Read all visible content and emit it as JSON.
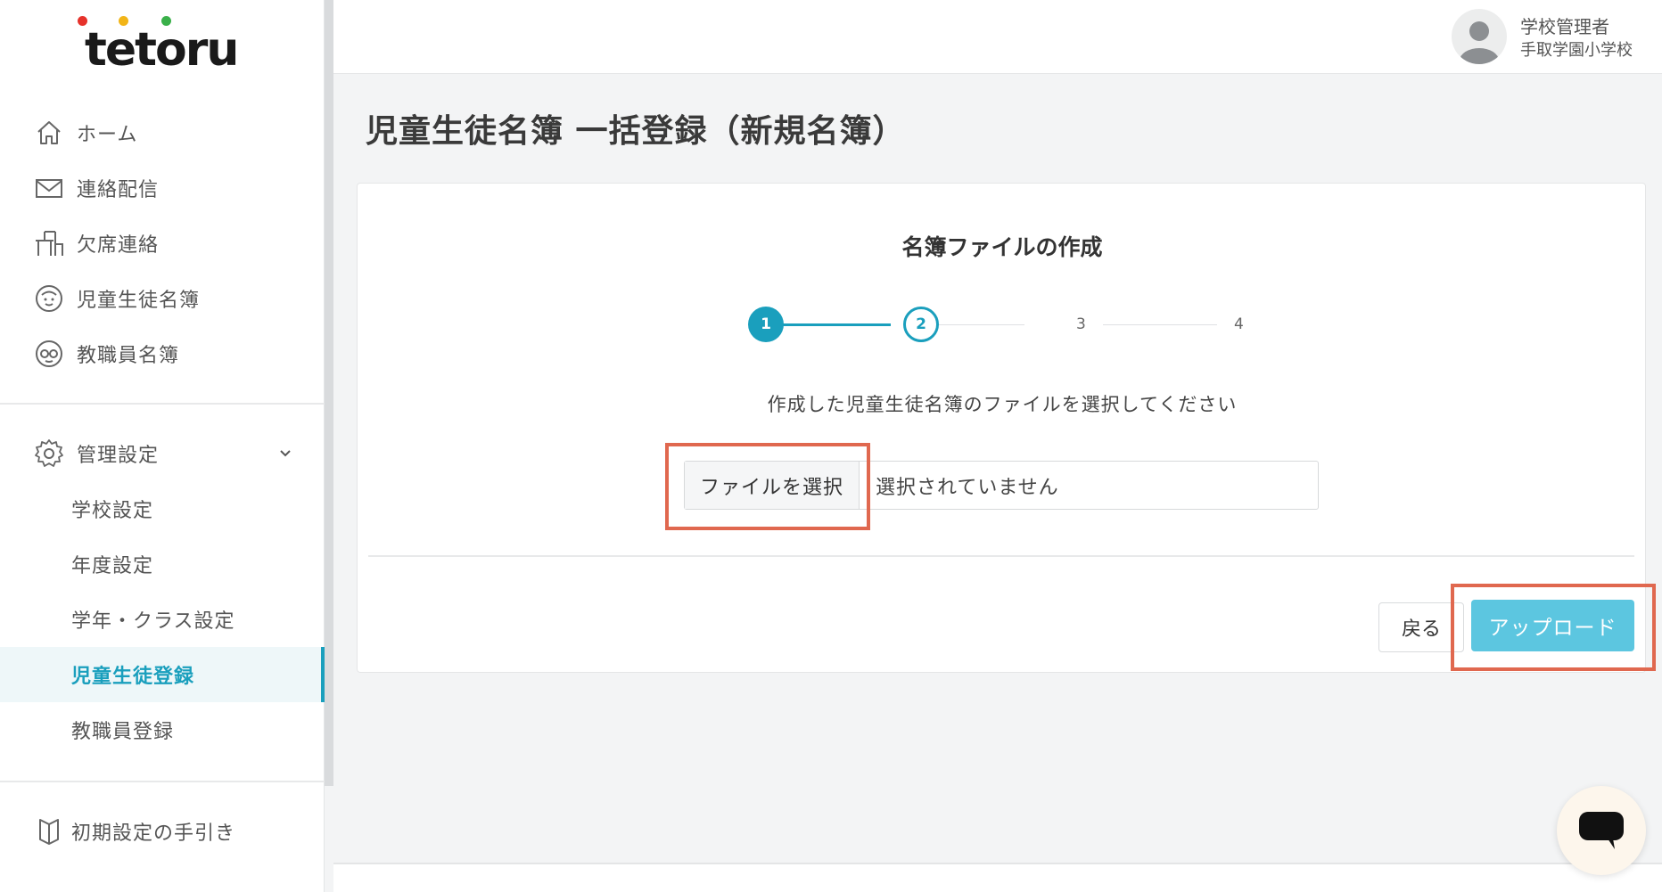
{
  "app": {
    "logo_text": "tetoru",
    "logo_colors": [
      "#e6322b",
      "#f2b518",
      "#3ab04a"
    ]
  },
  "sidebar": {
    "items": [
      {
        "label": "ホーム",
        "icon": "home-icon"
      },
      {
        "label": "連絡配信",
        "icon": "mail-icon"
      },
      {
        "label": "欠席連絡",
        "icon": "desk-chair-icon"
      },
      {
        "label": "児童生徒名簿",
        "icon": "student-face-icon"
      },
      {
        "label": "教職員名簿",
        "icon": "teacher-face-icon"
      }
    ],
    "admin": {
      "label": "管理設定",
      "icon": "gear-icon"
    },
    "sub_items": [
      {
        "label": "学校設定",
        "active": false
      },
      {
        "label": "年度設定",
        "active": false
      },
      {
        "label": "学年・クラス設定",
        "active": false
      },
      {
        "label": "児童生徒登録",
        "active": true
      },
      {
        "label": "教職員登録",
        "active": false
      }
    ],
    "guide": {
      "label": "初期設定の手引き",
      "icon": "book-icon"
    }
  },
  "header": {
    "user_role": "学校管理者",
    "school_name": "手取学園小学校"
  },
  "main": {
    "page_title": "児童生徒名簿 一括登録（新規名簿）",
    "card_title": "名簿ファイルの作成",
    "steps": {
      "labels": [
        "1",
        "2",
        "3",
        "4"
      ],
      "current": 2,
      "completed": 1
    },
    "instruction": "作成した児童生徒名簿のファイルを選択してください",
    "file_button": "ファイルを選択",
    "file_status": "選択されていません",
    "back_button": "戻る",
    "upload_button": "アップロード"
  },
  "colors": {
    "accent": "#1a9fbd",
    "upload": "#5cc6e0",
    "highlight": "#e0684f"
  }
}
